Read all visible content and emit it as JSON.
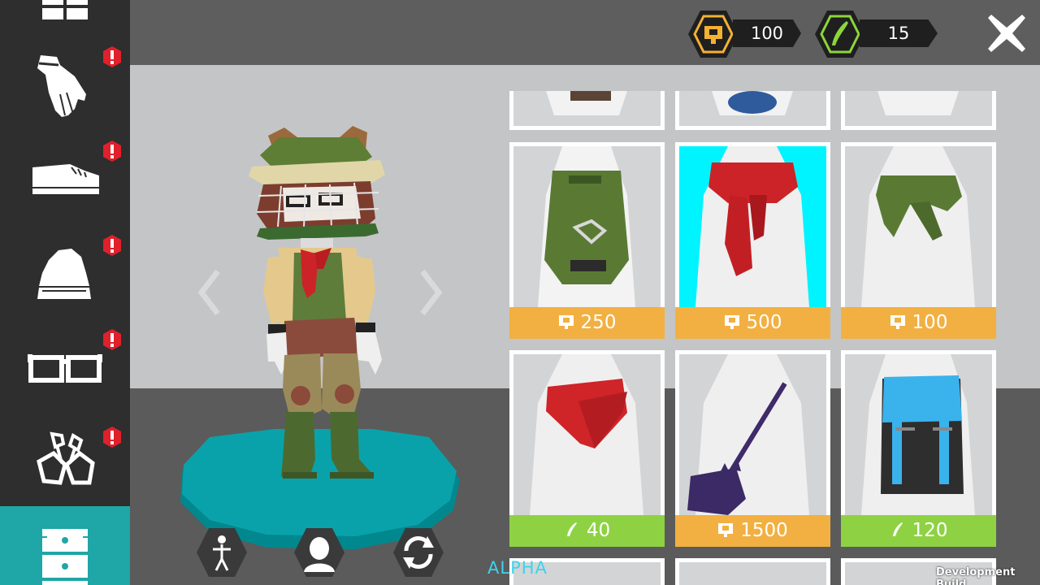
{
  "currencies": [
    {
      "name": "coins-icon",
      "value": "100",
      "color": "#f3b134"
    },
    {
      "name": "feathers-icon",
      "value": "15",
      "color": "#8cd63a"
    }
  ],
  "sidebar": {
    "items": [
      {
        "name": "pants",
        "alert": false
      },
      {
        "name": "gloves",
        "alert": true
      },
      {
        "name": "shoes",
        "alert": true
      },
      {
        "name": "hats",
        "alert": true
      },
      {
        "name": "glasses",
        "alert": true
      },
      {
        "name": "bike",
        "alert": true
      },
      {
        "name": "drawers",
        "alert": false,
        "active": true
      }
    ]
  },
  "shop": {
    "rows": [
      [
        {
          "item": "green-backpack",
          "price": "250",
          "currency": "coin",
          "price_color": "#f2b042"
        },
        {
          "item": "red-scarf",
          "price": "500",
          "currency": "coin",
          "price_color": "#f2b042",
          "selected": true
        },
        {
          "item": "green-tied-sweater",
          "price": "100",
          "currency": "coin",
          "price_color": "#f2b042"
        }
      ],
      [
        {
          "item": "red-bandana",
          "price": "40",
          "currency": "feather",
          "price_color": "#8ed244"
        },
        {
          "item": "purple-cat-bag",
          "price": "1500",
          "currency": "coin",
          "price_color": "#f2b042"
        },
        {
          "item": "blue-backpack",
          "price": "120",
          "currency": "feather",
          "price_color": "#8ed244"
        }
      ]
    ]
  },
  "labels": {
    "alpha": "ALPHA",
    "dev_build": "Development Build"
  },
  "colors": {
    "accent_teal": "#1fa6a6",
    "alert_red": "#e0202a",
    "selected_bg": "#00f4ff"
  }
}
